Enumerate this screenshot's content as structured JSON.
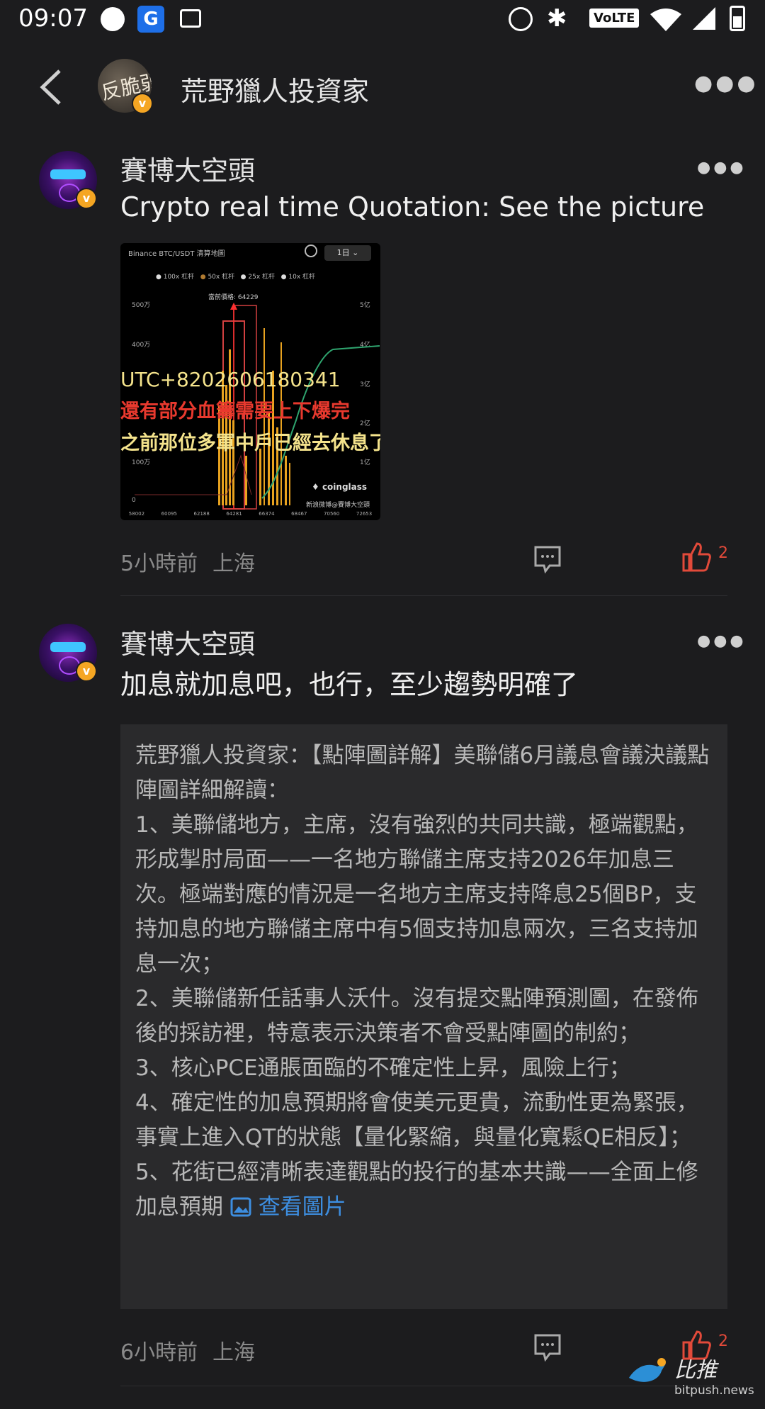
{
  "status_bar": {
    "time": "09:07",
    "network": "VoLTE"
  },
  "header": {
    "title": "荒野獵人投資家",
    "avatar_text": "反脆弱"
  },
  "posts": [
    {
      "username": "賽博大空頭",
      "text": "Crypto real time Quotation: See the picture",
      "time": "5小時前",
      "location": "上海",
      "likes": "2",
      "image": {
        "title": "Binance BTC/USDT 清算地圖",
        "period": "1日",
        "legend": [
          "100x 杠杆",
          "50x 杠杆",
          "25x 杠杆",
          "10x 杠杆"
        ],
        "current_price": "當前價格: 64229",
        "y_left_ticks": [
          "500万",
          "400万",
          "100万",
          "0"
        ],
        "y_right_ticks": [
          "5亿",
          "4亿",
          "3亿",
          "2亿",
          "1亿"
        ],
        "x_ticks": [
          "58002",
          "60095",
          "62188",
          "64281",
          "66374",
          "68467",
          "70560",
          "72653"
        ],
        "overlay_lines": [
          "UTC+8202606180341",
          "還有部分血籌需要上下爆完",
          "之前那位多軍中戶已經去休息了"
        ],
        "brand": "coinglass",
        "credit": "新浪微博@賽博大空頭"
      }
    },
    {
      "username": "賽博大空頭",
      "text": "加息就加息吧，也行，至少趨勢明確了",
      "quote": "荒野獵人投資家：【點陣圖詳解】美聯儲6月議息會議決議點陣圖詳細解讀：\n1、美聯儲地方，主席，沒有強烈的共同共識，極端觀點，形成掣肘局面——一名地方聯儲主席支持2026年加息三次。極端對應的情況是一名地方主席支持降息25個BP，支持加息的地方聯儲主席中有5個支持加息兩次，三名支持加息一次；\n2、美聯儲新任話事人沃什。沒有提交點陣預測圖，在發佈後的採訪裡，特意表示決策者不會受點陣圖的制約；\n3、核心PCE通脹面臨的不確定性上昇，風險上行；\n4、確定性的加息預期將會使美元更貴，流動性更為緊張，事實上進入QT的狀態【量化緊縮，與量化寬鬆QE相反】；\n5、花街已經清晰表達觀點的投行的基本共識——全面上修加息預期",
      "quote_link": "查看圖片",
      "time": "6小時前",
      "location": "上海",
      "likes": "2"
    }
  ],
  "watermark": {
    "name": "比推",
    "url": "bitpush.news"
  }
}
